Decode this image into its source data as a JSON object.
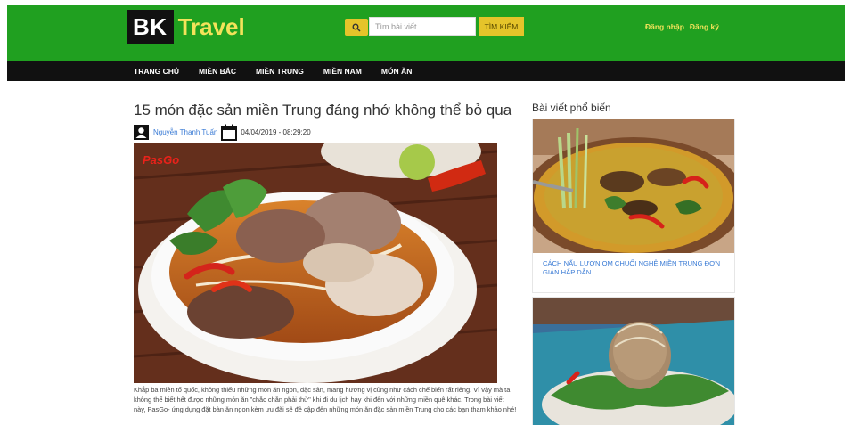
{
  "header": {
    "logo_part1": "BK",
    "logo_part2": "Travel",
    "search_placeholder": "Tìm bài viết",
    "search_button": "TÌM KIẾM",
    "login": "Đăng nhập",
    "register": "Đăng ký",
    "brand_green": "#20a020",
    "accent_yellow": "#e5c42a"
  },
  "nav": {
    "items": [
      "TRANG CHỦ",
      "MIỀN BẮC",
      "MIỀN TRUNG",
      "MIỀN NAM",
      "MÓN ĂN"
    ]
  },
  "article": {
    "title": "15 món đặc sản miền Trung đáng nhớ không thể bỏ qua",
    "author": "Nguyễn Thanh Tuấn",
    "date": "04/04/2019 - 08:29:20",
    "image_watermark": "PasGo",
    "body": "Khắp ba miền tổ quốc, không thiếu những món ăn ngon, đặc sản, mang hương vị cũng như cách chế biến rất riêng. Vì vậy mà ta không thể biết hết được những món ăn \"chắc chắn phải thử\" khi đi du lịch hay khi đến với những miền quê khác. Trong bài viết này, PasGo- ứng dụng đặt bàn ăn ngon kèm ưu đãi sẽ đề cập đến những món ăn đặc sản miền Trung cho các bạn tham khảo nhé!"
  },
  "sidebar": {
    "title": "Bài viết phổ biến",
    "posts": [
      {
        "title": "CÁCH NẤU LƯƠN OM CHUỐI NGHỆ MIỀN TRUNG ĐƠN GIẢN HẤP DẪN"
      },
      {
        "title": ""
      }
    ]
  },
  "icons": {
    "search": "search-icon",
    "user": "user-icon",
    "calendar": "calendar-icon"
  }
}
